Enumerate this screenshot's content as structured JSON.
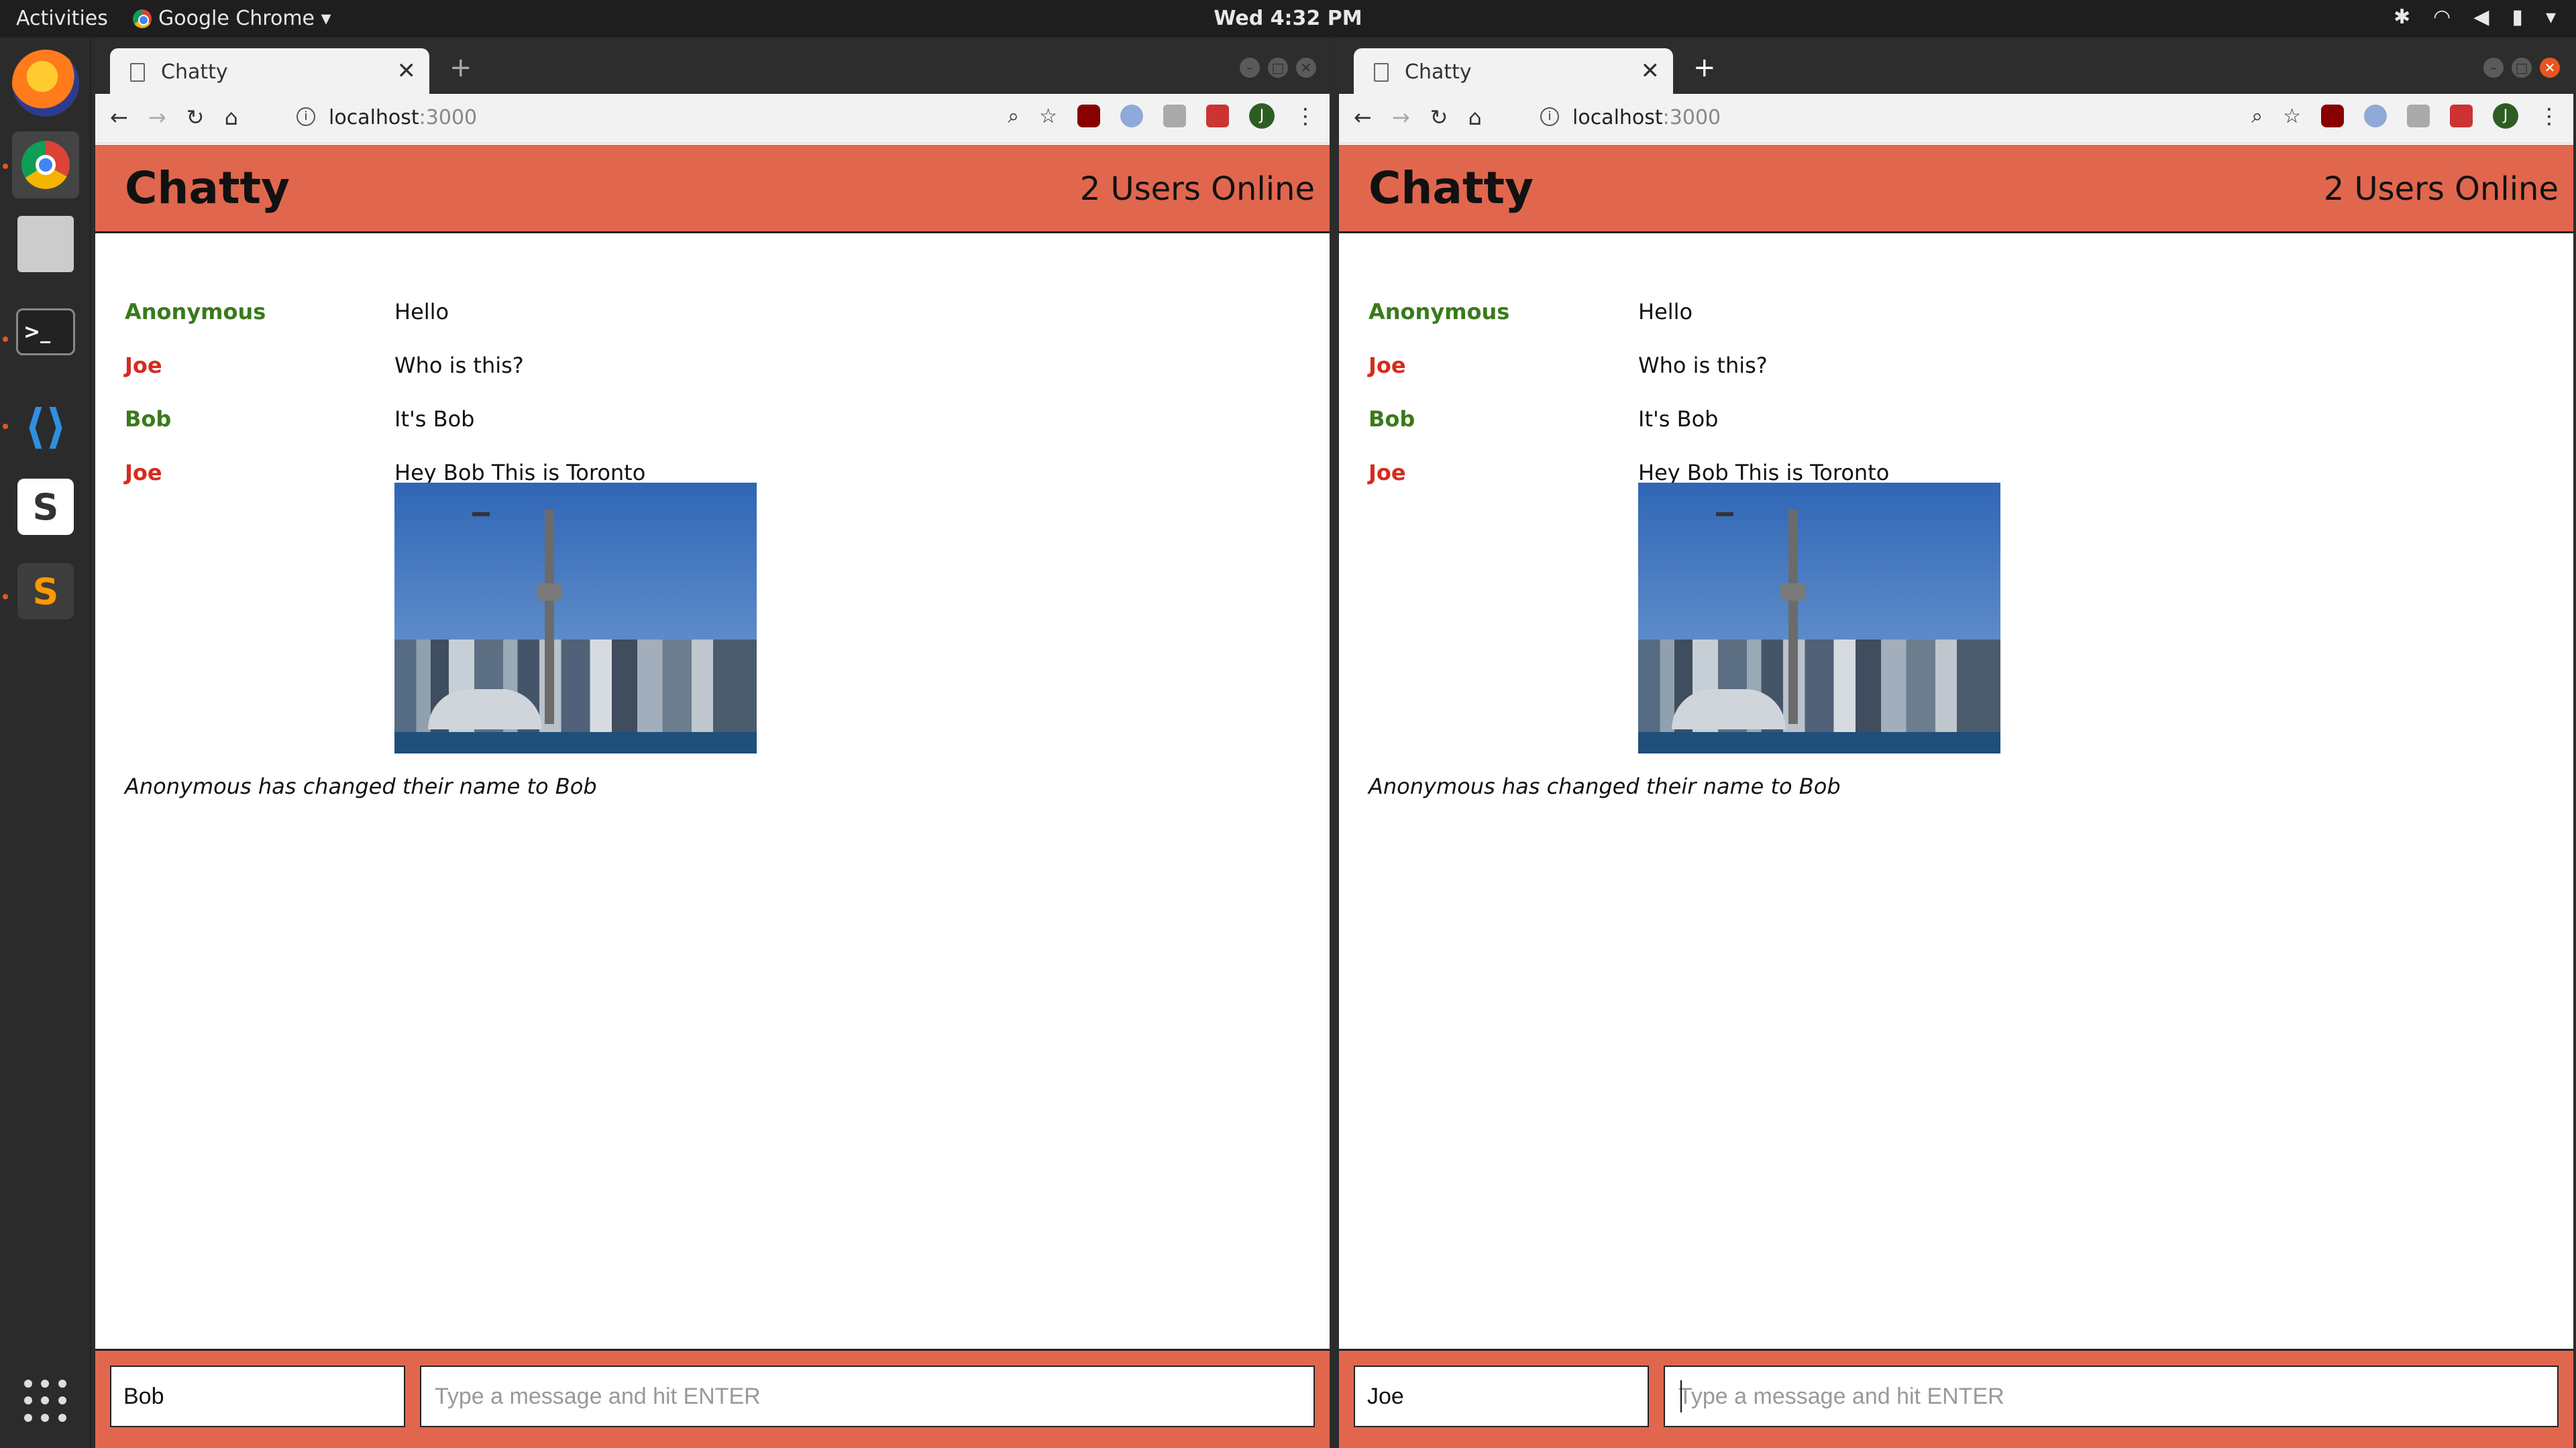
{
  "desktop": {
    "activities_label": "Activities",
    "app_menu_label": "Google Chrome ▾",
    "clock": "Wed  4:32 PM",
    "tray_icons": [
      "settings-icon",
      "wifi-icon",
      "volume-muted-icon",
      "battery-icon",
      "system-menu-icon"
    ],
    "dock_apps": [
      "firefox",
      "chrome",
      "files",
      "terminal",
      "vscode",
      "slack",
      "sublime-text"
    ],
    "accent": "#e95420"
  },
  "windows": [
    {
      "tab_title": "Chatty",
      "url_host": "localhost",
      "url_port": ":3000",
      "avatar_letter": "J",
      "app": {
        "brand": "Chatty",
        "online": "2 Users Online",
        "messages": [
          {
            "user": "Anonymous",
            "text": "Hello",
            "color": "#3a7a1b"
          },
          {
            "user": "Joe",
            "text": "Who is this?",
            "color": "#d62b1e"
          },
          {
            "user": "Bob",
            "text": "It's Bob",
            "color": "#3a7a1b"
          },
          {
            "user": "Joe",
            "text": "Hey Bob This is Toronto",
            "color": "#d62b1e"
          }
        ],
        "notification": "Anonymous has changed their name to Bob",
        "username_value": "Bob",
        "message_placeholder": "Type a message and hit ENTER"
      }
    },
    {
      "tab_title": "Chatty",
      "url_host": "localhost",
      "url_port": ":3000",
      "avatar_letter": "J",
      "app": {
        "brand": "Chatty",
        "online": "2 Users Online",
        "messages": [
          {
            "user": "Anonymous",
            "text": "Hello",
            "color": "#3a7a1b"
          },
          {
            "user": "Joe",
            "text": "Who is this?",
            "color": "#d62b1e"
          },
          {
            "user": "Bob",
            "text": "It's Bob",
            "color": "#3a7a1b"
          },
          {
            "user": "Joe",
            "text": "Hey Bob This is Toronto",
            "color": "#d62b1e"
          }
        ],
        "notification": "Anonymous has changed their name to Bob",
        "username_value": "Joe",
        "message_placeholder": "Type a message and hit ENTER"
      }
    }
  ],
  "colors": {
    "header_bg": "#e0674e",
    "user_green": "#3a7a1b",
    "user_red": "#d62b1e"
  }
}
